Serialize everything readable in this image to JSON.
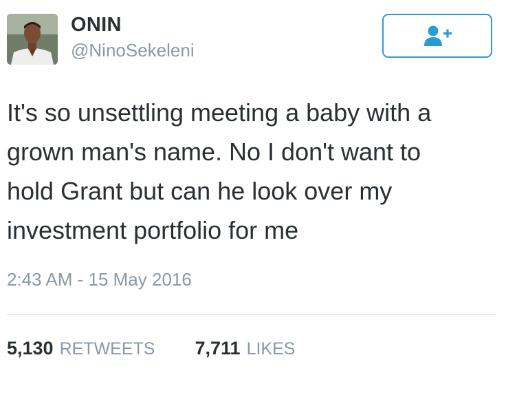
{
  "user": {
    "display_name": "ONIN",
    "handle": "@NinoSekeleni"
  },
  "follow_button": {
    "icon": "add-user-icon",
    "color": "#2b9bd7"
  },
  "tweet": {
    "text": "It's so unsettling meeting a baby with a\ngrown man's name. No I don't want to\nhold Grant but can he look over my\ninvestment portfolio for me",
    "timestamp": "2:43 AM - 15 May 2016"
  },
  "stats": {
    "retweets_count": "5,130",
    "retweets_label": "RETWEETS",
    "likes_count": "7,711",
    "likes_label": "LIKES"
  },
  "colors": {
    "text": "#292f33",
    "muted": "#8899a6",
    "divider": "#e6ecf0",
    "accent": "#2b9bd7"
  }
}
